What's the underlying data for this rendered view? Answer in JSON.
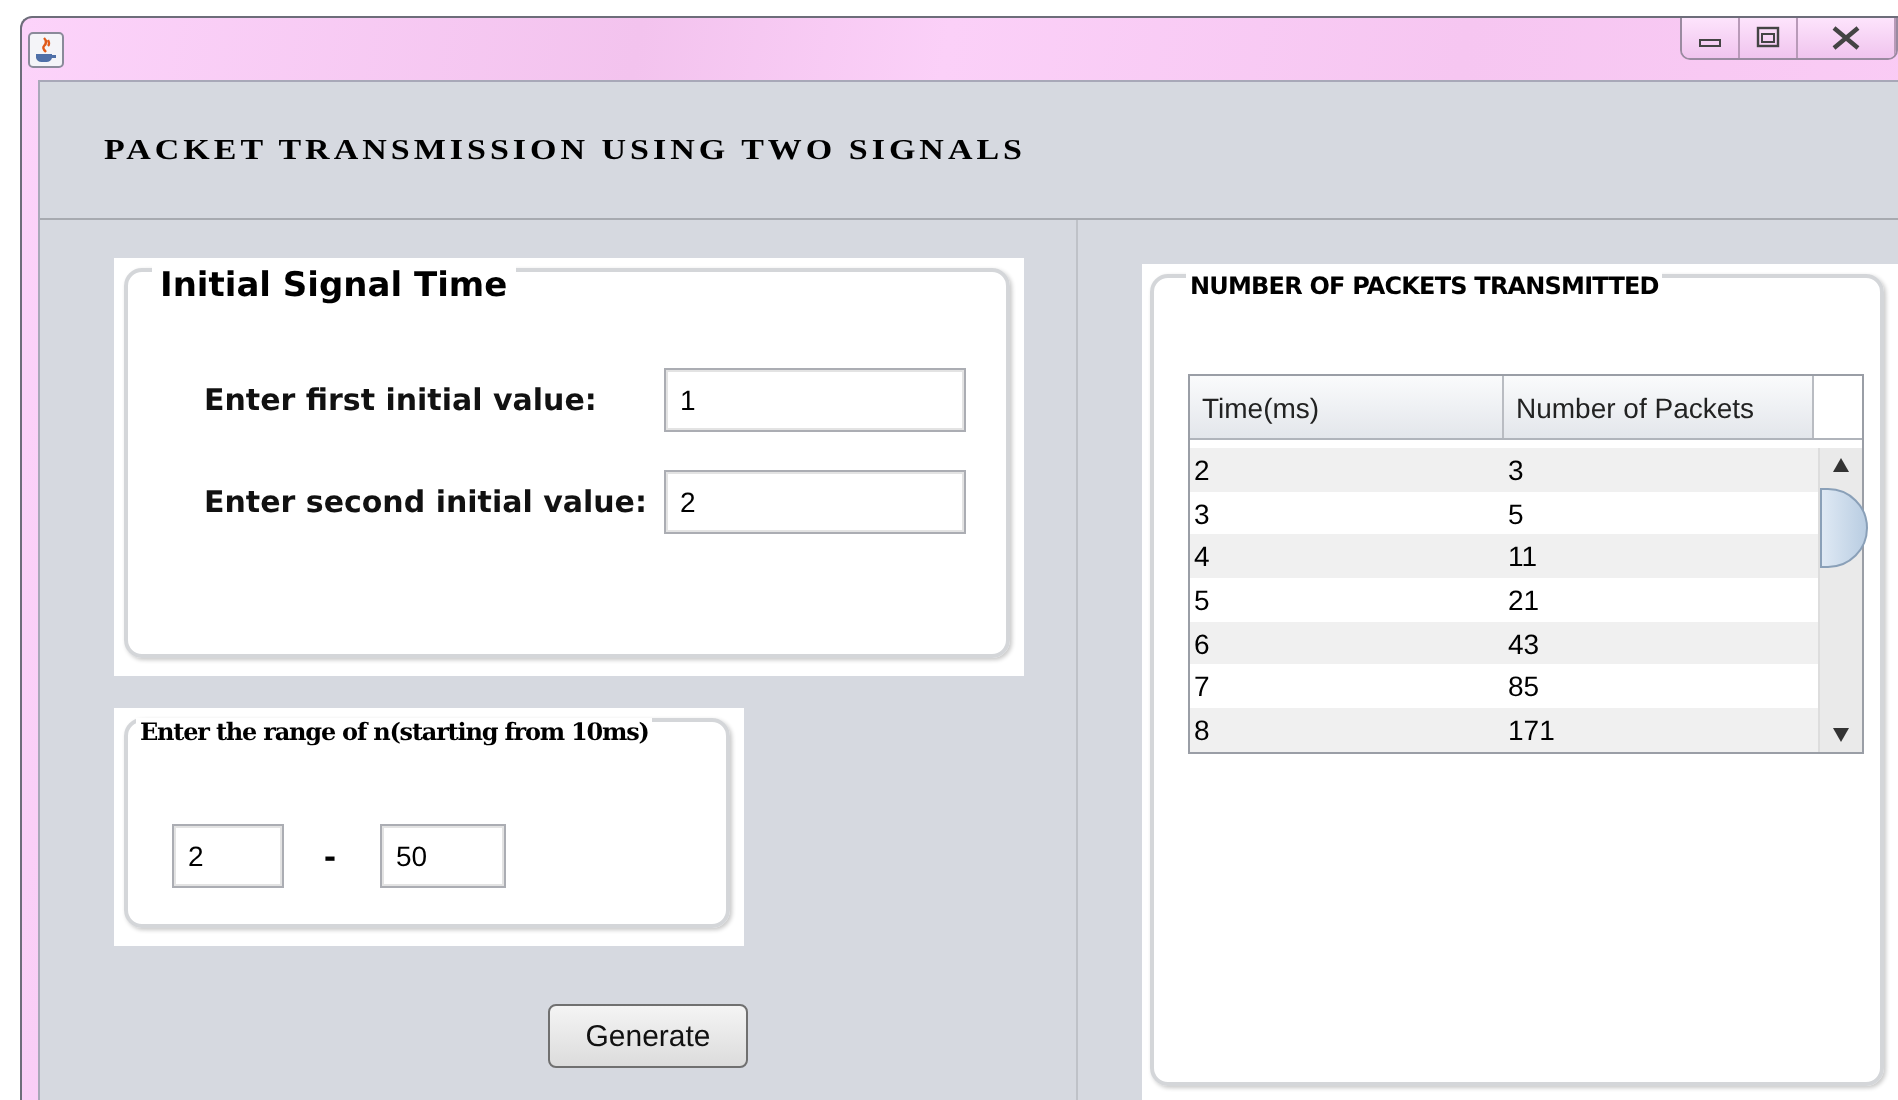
{
  "window": {
    "heading": "PACKET TRANSMISSION USING TWO SIGNALS"
  },
  "initial_panel": {
    "title": "Initial Signal Time",
    "fields": [
      {
        "label": "Enter first initial value:",
        "value": "1"
      },
      {
        "label": "Enter second initial value:",
        "value": "2"
      }
    ]
  },
  "range_panel": {
    "title": "Enter the range of n(starting from 10ms)",
    "from": "2",
    "separator": "-",
    "to": "50"
  },
  "generate_button": "Generate",
  "results_panel": {
    "title": "NUMBER OF PACKETS TRANSMITTED",
    "table": {
      "columns": [
        "Time(ms)",
        "Number of Packets"
      ],
      "rows": [
        [
          "2",
          "3"
        ],
        [
          "3",
          "5"
        ],
        [
          "4",
          "11"
        ],
        [
          "5",
          "21"
        ],
        [
          "6",
          "43"
        ],
        [
          "7",
          "85"
        ],
        [
          "8",
          "171"
        ]
      ]
    }
  }
}
